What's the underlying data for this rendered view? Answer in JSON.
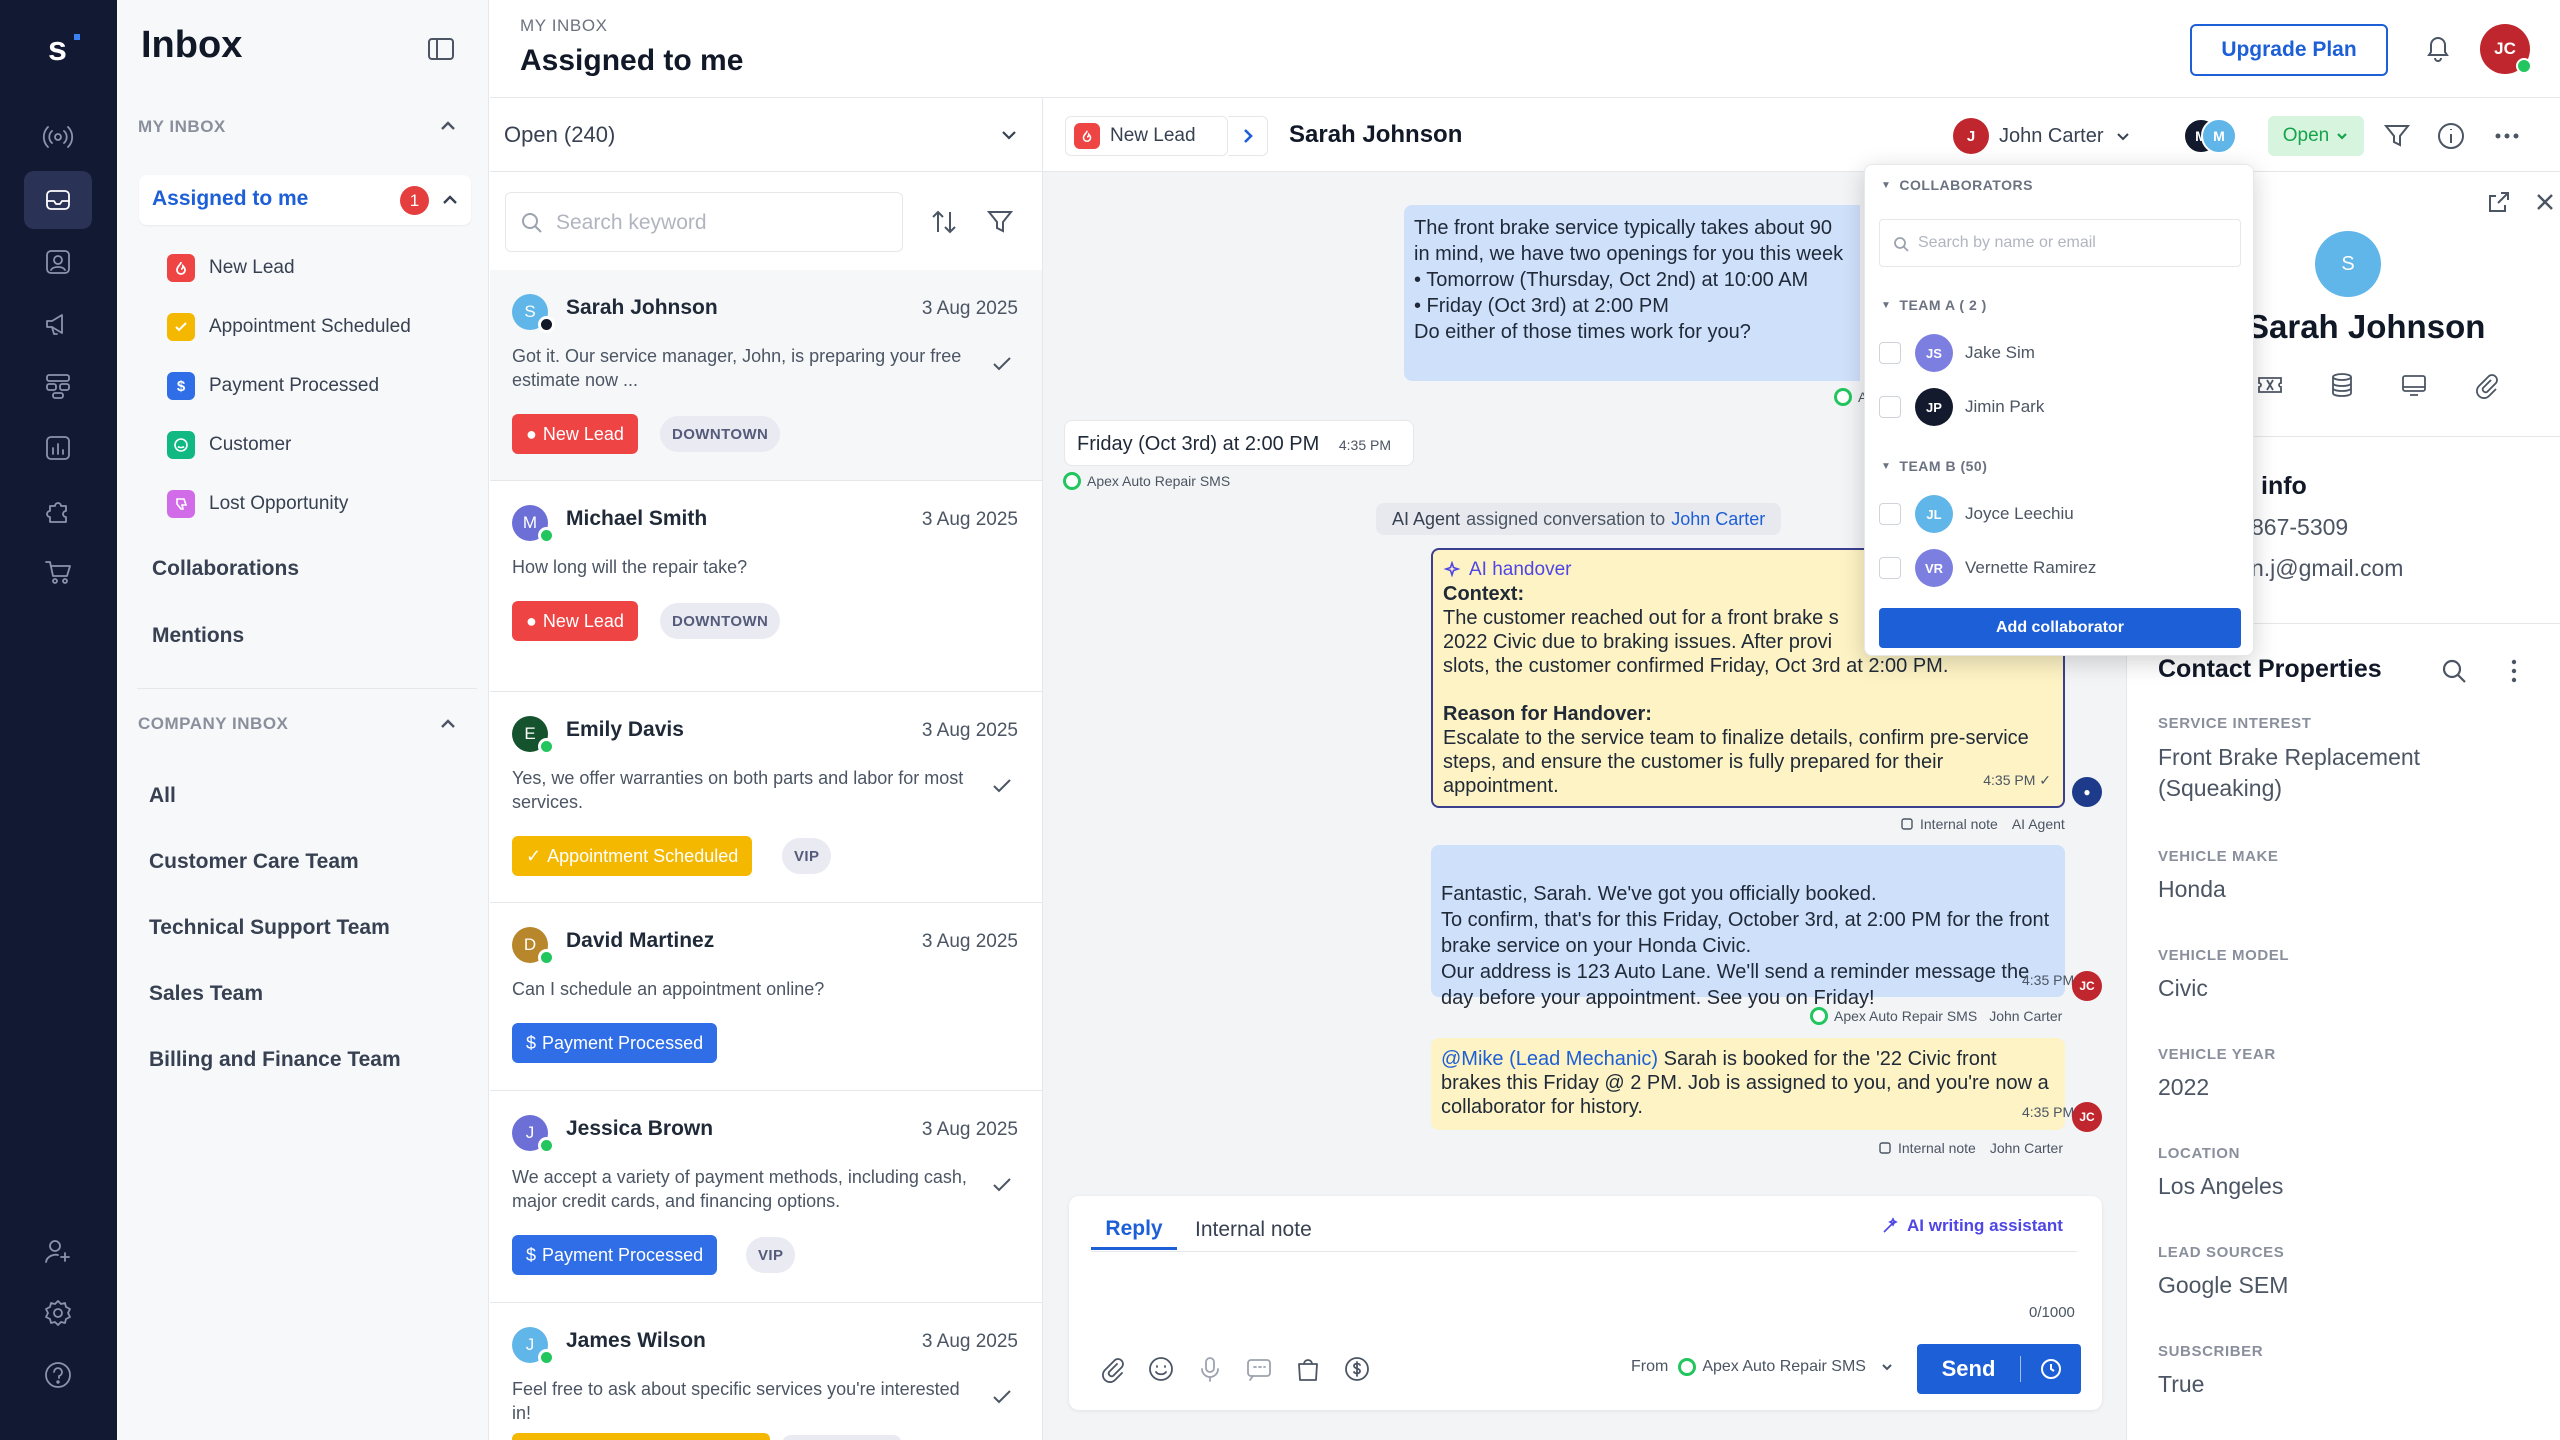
{
  "app": {
    "logo_letter": "s",
    "brand_color": "#121a33",
    "accent": "#1d5fd6"
  },
  "rail": {
    "icons": [
      "broadcast-icon",
      "inbox-icon",
      "contacts-icon",
      "megaphone-icon",
      "workflow-icon",
      "reports-icon",
      "integrations-icon",
      "cart-icon",
      "add-user-icon",
      "settings-icon",
      "help-icon"
    ]
  },
  "sidebar": {
    "title": "Inbox",
    "my_inbox_label": "MY INBOX",
    "assigned_label": "Assigned to me",
    "assigned_count": "1",
    "stages": [
      {
        "label": "New Lead",
        "color": "#ef4444",
        "icon": "fire-icon"
      },
      {
        "label": "Appointment Scheduled",
        "color": "#f5b800",
        "icon": "check-icon"
      },
      {
        "label": "Payment Processed",
        "color": "#2f6ee6",
        "icon": "dollar-icon"
      },
      {
        "label": "Customer",
        "color": "#10b981",
        "icon": "smile-icon"
      },
      {
        "label": "Lost Opportunity",
        "color": "#d16be8",
        "icon": "thumbs-down-icon"
      }
    ],
    "collaborations": "Collaborations",
    "mentions": "Mentions",
    "company_inbox_label": "COMPANY INBOX",
    "teams": [
      "All",
      "Customer Care Team",
      "Technical Support Team",
      "Sales Team",
      "Billing and Finance Team"
    ]
  },
  "header": {
    "breadcrumb": "MY INBOX",
    "title": "Assigned to me",
    "upgrade": "Upgrade Plan",
    "user_initials": "JC"
  },
  "list": {
    "filter": "Open (240)",
    "search_placeholder": "Search keyword",
    "items": [
      {
        "initial": "S",
        "name": "Sarah Johnson",
        "date": "3 Aug 2025",
        "message": "Got it. Our service manager, John, is preparing your free estimate now ...",
        "tag": "New Lead",
        "tag_color": "#ef4444",
        "chip": "DOWNTOWN",
        "av_color": "#60b6e8"
      },
      {
        "initial": "M",
        "name": "Michael Smith",
        "date": "3 Aug 2025",
        "message": "How long will the repair take?",
        "tag": "New Lead",
        "tag_color": "#ef4444",
        "chip": "DOWNTOWN",
        "av_color": "#6b6fd6"
      },
      {
        "initial": "E",
        "name": "Emily Davis",
        "date": "3 Aug 2025",
        "message": "Yes, we offer warranties on both parts and labor for most services.",
        "tag": "Appointment Scheduled",
        "tag_color": "#f5b800",
        "chip": "VIP",
        "av_color": "#14532d"
      },
      {
        "initial": "D",
        "name": "David Martinez",
        "date": "3 Aug 2025",
        "message": "Can I schedule an appointment online?",
        "tag": "Payment Processed",
        "tag_color": "#2f6ee6",
        "chip": "",
        "av_color": "#b8862b"
      },
      {
        "initial": "J",
        "name": "Jessica Brown",
        "date": "3 Aug 2025",
        "message": "We accept a variety of payment methods, including cash, major credit cards, and financing options.",
        "tag": "Payment Processed",
        "tag_color": "#2f6ee6",
        "chip": "VIP",
        "av_color": "#6b6fd6"
      },
      {
        "initial": "J",
        "name": "James Wilson",
        "date": "3 Aug 2025",
        "message": "Feel free to ask about specific services you're interested in!",
        "tag": "",
        "tag_color": "#f5b800",
        "chip": "",
        "av_color": "#60b6e8"
      }
    ]
  },
  "chat": {
    "stage": "New Lead",
    "contact_name": "Sarah Johnson",
    "assignee": "John Carter",
    "assignee_initial": "J",
    "status": "Open",
    "outgoing_1": [
      "The front brake service typically takes about 90",
      "in mind, we have two openings for you this week",
      "• Tomorrow (Thursday, Oct 2nd) at 10:00 AM",
      "• Friday (Oct 3rd) at 2:00 PM",
      "Do either of those times work for you?"
    ],
    "incoming_1": "Friday (Oct 3rd) at 2:00 PM",
    "incoming_1_time": "4:35 PM",
    "channel": "Apex Auto Repair SMS",
    "system_actor": "AI Agent",
    "system_text": "assigned conversation to",
    "system_target": "John Carter",
    "ai_title": "AI handover",
    "ai_context_label": "Context:",
    "ai_context": [
      "The customer reached out for a front brake s",
      "2022 Civic due to braking issues. After provi",
      "slots, the customer confirmed Friday, Oct 3rd at 2:00 PM."
    ],
    "ai_reason_label": "Reason for Handover:",
    "ai_reason": "Escalate to the service team to finalize details, confirm pre-service steps, and ensure the customer is fully prepared for their appointment.",
    "ai_time": "4:35 PM",
    "internal_note": "Internal note",
    "ai_agent": "AI Agent",
    "outgoing_2": "Fantastic, Sarah. We've got you officially booked.\nTo confirm, that's for this Friday, October 3rd, at 2:00 PM for the front brake service on your Honda Civic.\nOur address is 123 Auto Lane. We'll send a reminder message the day before your appointment. See you on Friday!",
    "outgoing_2_time": "4:35 PM",
    "sender": "John Carter",
    "note_mention": "@Mike (Lead Mechanic)",
    "note_text": " Sarah is booked for the '22 Civic front brakes this Friday @ 2 PM. Job is assigned to you, and you're now a collaborator for history.",
    "note_time": "4:35 PM"
  },
  "composer": {
    "reply_tab": "Reply",
    "note_tab": "Internal note",
    "ai_writer": "AI writing assistant",
    "counter": "0/1000",
    "from_label": "From",
    "from_channel": "Apex Auto Repair SMS",
    "send": "Send"
  },
  "contact": {
    "initial": "S",
    "name": "Sarah Johnson",
    "info_title": "info",
    "phone": "867-5309",
    "email": "n.j@gmail.com",
    "props_title": "Contact Properties",
    "properties": [
      {
        "label": "SERVICE INTEREST",
        "value": "Front Brake Replacement (Squeaking)"
      },
      {
        "label": "VEHICLE MAKE",
        "value": "Honda"
      },
      {
        "label": "VEHICLE MODEL",
        "value": "Civic"
      },
      {
        "label": "VEHICLE YEAR",
        "value": "2022"
      },
      {
        "label": "LOCATION",
        "value": "Los Angeles"
      },
      {
        "label": "LEAD SOURCES",
        "value": "Google SEM"
      },
      {
        "label": "SUBSCRIBER",
        "value": "True"
      }
    ]
  },
  "collaborators": {
    "title": "COLLABORATORS",
    "search_placeholder": "Search by name or email",
    "team_a": "TEAM A ( 2 )",
    "team_b": "TEAM B (50)",
    "members_a": [
      {
        "initials": "JS",
        "name": "Jake Sim",
        "color": "#7c7fe0"
      },
      {
        "initials": "JP",
        "name": "Jimin Park",
        "color": "#141a2e"
      }
    ],
    "members_b": [
      {
        "initials": "JL",
        "name": "Joyce Leechiu",
        "color": "#60b6e8"
      },
      {
        "initials": "VR",
        "name": "Vernette Ramirez",
        "color": "#7c7fe0"
      }
    ],
    "add_button": "Add collaborator"
  }
}
